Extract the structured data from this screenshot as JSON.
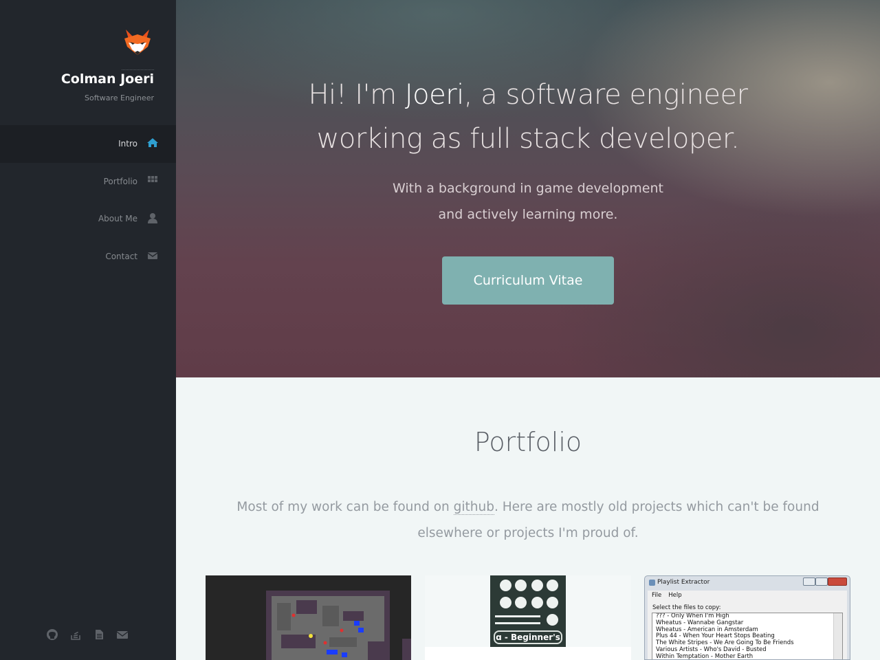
{
  "sidebar": {
    "name": "Colman Joeri",
    "role": "Software Engineer",
    "logo_icon": "fox-icon",
    "nav": [
      {
        "label": "Intro",
        "icon": "home-icon",
        "active": true
      },
      {
        "label": "Portfolio",
        "icon": "grid-icon",
        "active": false
      },
      {
        "label": "About Me",
        "icon": "user-icon",
        "active": false
      },
      {
        "label": "Contact",
        "icon": "envelope-icon",
        "active": false
      }
    ],
    "socials": [
      "github-icon",
      "stack-overflow-icon",
      "document-icon",
      "envelope-icon"
    ]
  },
  "hero": {
    "title_pre": "Hi! I'm ",
    "title_name": "Joeri",
    "title_post1": ", a software engineer",
    "title_line2": "working as full stack developer.",
    "sub_line1": "With a background in game development",
    "sub_line2": "and actively learning more.",
    "button_label": "Curriculum Vitae"
  },
  "portfolio": {
    "title": "Portfolio",
    "desc_pre": "Most of my work can be found on ",
    "desc_link": "github",
    "desc_post": ". Here are mostly old projects which can't be found elsewhere or projects I'm proud of.",
    "thumbs": {
      "player_label": "ɑ - Beginner's",
      "window_title": "Playlist Extractor",
      "window_menu": [
        "File",
        "Help"
      ],
      "window_label": "Select the files to copy:",
      "window_items": [
        "??? - Only When I'm High",
        "Wheatus - Wannabe Gangstar",
        "Wheatus - American in Amsterdam",
        "Plus 44 - When Your Heart Stops Beating",
        "The White Stripes - We Are Going To Be Friends",
        "Various Artists - Who's David - Busted",
        "Within Temptation - Mother Earth"
      ]
    }
  },
  "colors": {
    "sidebar": "#22262c",
    "accent": "#2f9fd0",
    "button": "#7fb1b0"
  }
}
